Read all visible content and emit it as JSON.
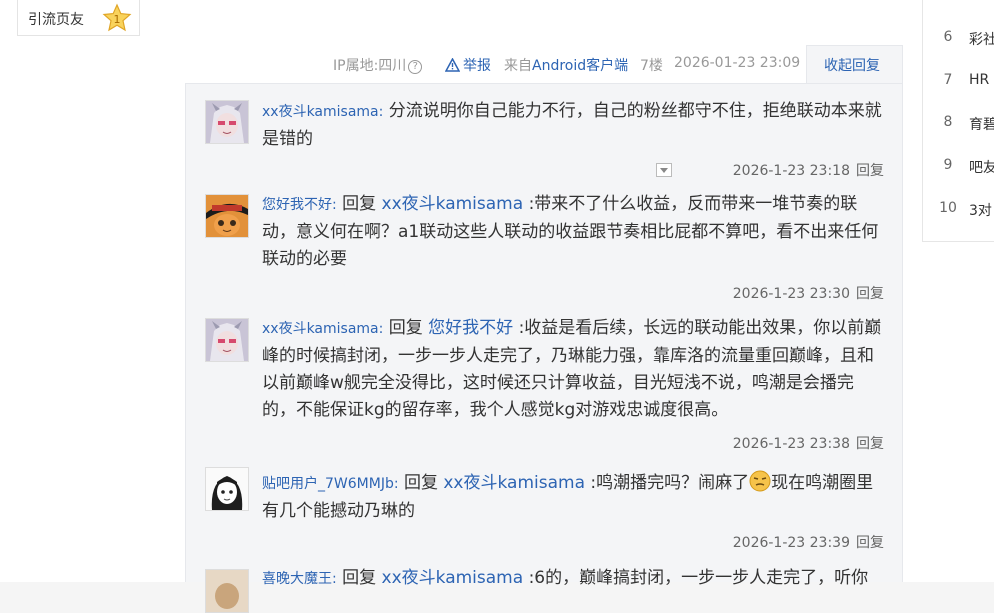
{
  "left_badge": {
    "label": "引流页友",
    "level": "1"
  },
  "meta": {
    "ip": "IP属地:四川",
    "help": "?",
    "report": "举报",
    "from_prefix": "来自",
    "from_client": "Android客户端",
    "floor": "7楼",
    "datetime": "2026-01-23 23:09",
    "collapse": "收起回复"
  },
  "comments": [
    {
      "user": "xx夜斗kamisama:",
      "reply_word": "",
      "reply_to": "",
      "text": "分流说明你自己能力不行，自己的粉丝都守不住，拒绝联动本来就是错的",
      "time": "2026-1-23 23:18",
      "reply": "回复"
    },
    {
      "user": "您好我不好:",
      "reply_word": "回复",
      "reply_to": "xx夜斗kamisama",
      "text": ":带来不了什么收益，反而带来一堆节奏的联动，意义何在啊？a1联动这些人联动的收益跟节奏相比屁都不算吧，看不出来任何联动的必要",
      "time": "2026-1-23 23:30",
      "reply": "回复"
    },
    {
      "user": "xx夜斗kamisama:",
      "reply_word": "回复",
      "reply_to": "您好我不好",
      "text": ":收益是看后续，长远的联动能出效果，你以前巅峰的时候搞封闭，一步一步人走完了，乃琳能力强，靠库洛的流量重回巅峰，且和以前巅峰w舰完全没得比，这时候还只计算收益，目光短浅不说，鸣潮是会播完的，不能保证kg的留存率，我个人感觉kg对游戏忠诚度很高。",
      "time": "2026-1-23 23:38",
      "reply": "回复"
    },
    {
      "user": "贴吧用户_7W6MMJb:",
      "reply_word": "回复",
      "reply_to": "xx夜斗kamisama",
      "text": ":鸣潮播完吗？闹麻了",
      "text2": "现在鸣潮圈里有几个能撼动乃琳的",
      "time": "2026-1-23 23:39",
      "reply": "回复"
    },
    {
      "user": "喜晚大魔王:",
      "reply_word": "回复",
      "reply_to": "xx夜斗kamisama",
      "text": ":6的，巅峰搞封闭，一步一步人走完了，听你"
    }
  ],
  "right_rank": [
    {
      "n": "6",
      "t": "彩社"
    },
    {
      "n": "7",
      "t": "HR"
    },
    {
      "n": "8",
      "t": "育碧"
    },
    {
      "n": "9",
      "t": "吧友"
    },
    {
      "n": "10",
      "t": "3对"
    }
  ]
}
